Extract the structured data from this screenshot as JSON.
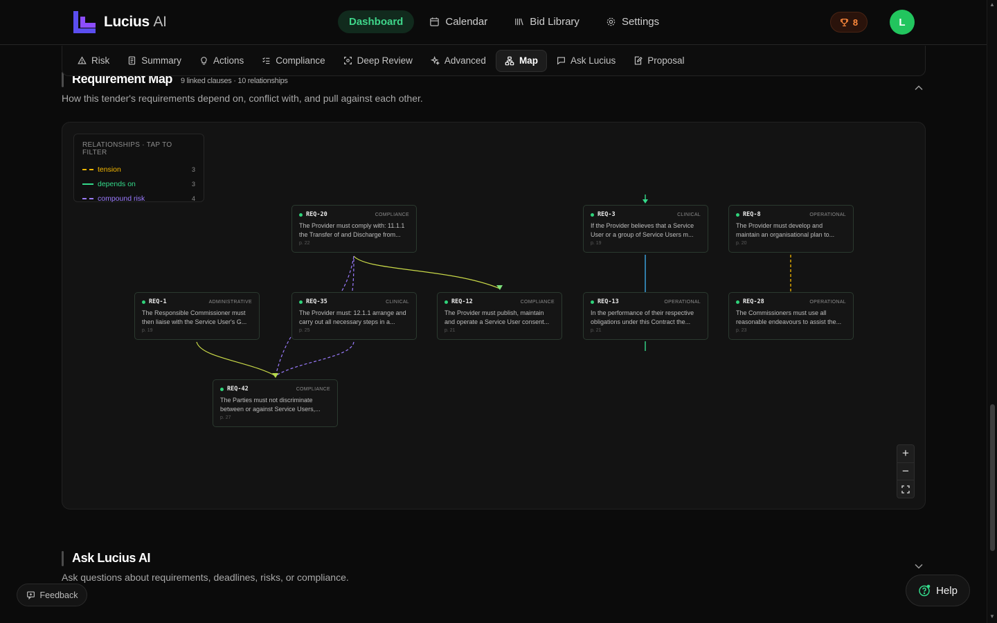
{
  "brand": {
    "name": "Lucius",
    "suffix": "AI"
  },
  "main_nav": [
    {
      "label": "Dashboard",
      "icon": "dashboard",
      "active": true
    },
    {
      "label": "Calendar",
      "icon": "calendar-icon",
      "active": false
    },
    {
      "label": "Bid Library",
      "icon": "library-icon",
      "active": false
    },
    {
      "label": "Settings",
      "icon": "gear-icon",
      "active": false
    }
  ],
  "trophy_count": "8",
  "avatar_initial": "L",
  "tabs": [
    {
      "label": "Risk",
      "icon": "warning-icon",
      "active": false
    },
    {
      "label": "Summary",
      "icon": "document-icon",
      "active": false
    },
    {
      "label": "Actions",
      "icon": "lightbulb-icon",
      "active": false
    },
    {
      "label": "Compliance",
      "icon": "checklist-icon",
      "active": false
    },
    {
      "label": "Deep Review",
      "icon": "scan-icon",
      "active": false
    },
    {
      "label": "Advanced",
      "icon": "sparkle-icon",
      "active": false
    },
    {
      "label": "Map",
      "icon": "network-icon",
      "active": true
    },
    {
      "label": "Ask Lucius",
      "icon": "chat-icon",
      "active": false
    },
    {
      "label": "Proposal",
      "icon": "edit-document-icon",
      "active": false
    }
  ],
  "req_map": {
    "title": "Requirement Map",
    "meta": "9 linked clauses · 10 relationships",
    "description": "How this tender's requirements depend on, conflict with, and pull against each other.",
    "legend": {
      "title": "RELATIONSHIPS · TAP TO FILTER",
      "items": [
        {
          "label": "tension",
          "count": "3",
          "color": "#f5b800",
          "dashed": true
        },
        {
          "label": "depends on",
          "count": "3",
          "color": "#34d98a",
          "dashed": false
        },
        {
          "label": "compound risk",
          "count": "4",
          "color": "#9b7bff",
          "dashed": true
        }
      ]
    },
    "nodes": [
      {
        "id": "REQ-20",
        "category": "COMPLIANCE",
        "text": "The Provider must comply with: 11.1.1 the Transfer of and Discharge from...",
        "page": "p. 22"
      },
      {
        "id": "REQ-3",
        "category": "CLINICAL",
        "text": "If the Provider believes that a Service User or a group of Service Users m...",
        "page": "p. 19"
      },
      {
        "id": "REQ-8",
        "category": "OPERATIONAL",
        "text": "The Provider must develop and maintain an organisational plan to...",
        "page": "p. 20"
      },
      {
        "id": "REQ-1",
        "category": "ADMINISTRATIVE",
        "text": "The Responsible Commissioner must then liaise with the Service User's G...",
        "page": "p. 19"
      },
      {
        "id": "REQ-35",
        "category": "CLINICAL",
        "text": "The Provider must: 12.1.1 arrange and carry out all necessary steps in a...",
        "page": "p. 25"
      },
      {
        "id": "REQ-12",
        "category": "COMPLIANCE",
        "text": "The Provider must publish, maintain and operate a Service User consent...",
        "page": "p. 21"
      },
      {
        "id": "REQ-13",
        "category": "OPERATIONAL",
        "text": "In the performance of their respective obligations under this Contract the...",
        "page": "p. 21"
      },
      {
        "id": "REQ-28",
        "category": "OPERATIONAL",
        "text": "The Commissioners must use all reasonable endeavours to assist the...",
        "page": "p. 23"
      },
      {
        "id": "REQ-42",
        "category": "COMPLIANCE",
        "text": "The Parties must not discriminate between or against Service Users,...",
        "page": "p. 27"
      }
    ],
    "edges": [
      {
        "from": "REQ-20",
        "to": "REQ-12",
        "type": "tension"
      },
      {
        "from": "REQ-35",
        "to": "REQ-20",
        "type": "compound risk"
      },
      {
        "from": "REQ-35",
        "to": "REQ-42",
        "type": "compound risk"
      },
      {
        "from": "REQ-1",
        "to": "REQ-42",
        "type": "tension"
      },
      {
        "from": "REQ-3",
        "to": "REQ-13",
        "type": "depends on"
      },
      {
        "from": "REQ-8",
        "to": "REQ-28",
        "type": "tension"
      }
    ],
    "zoom": {
      "in": "+",
      "out": "−",
      "fit": "⛶"
    }
  },
  "ask": {
    "title": "Ask Lucius AI",
    "description": "Ask questions about requirements, deadlines, risks, or compliance."
  },
  "feedback_label": "Feedback",
  "help_label": "Help"
}
